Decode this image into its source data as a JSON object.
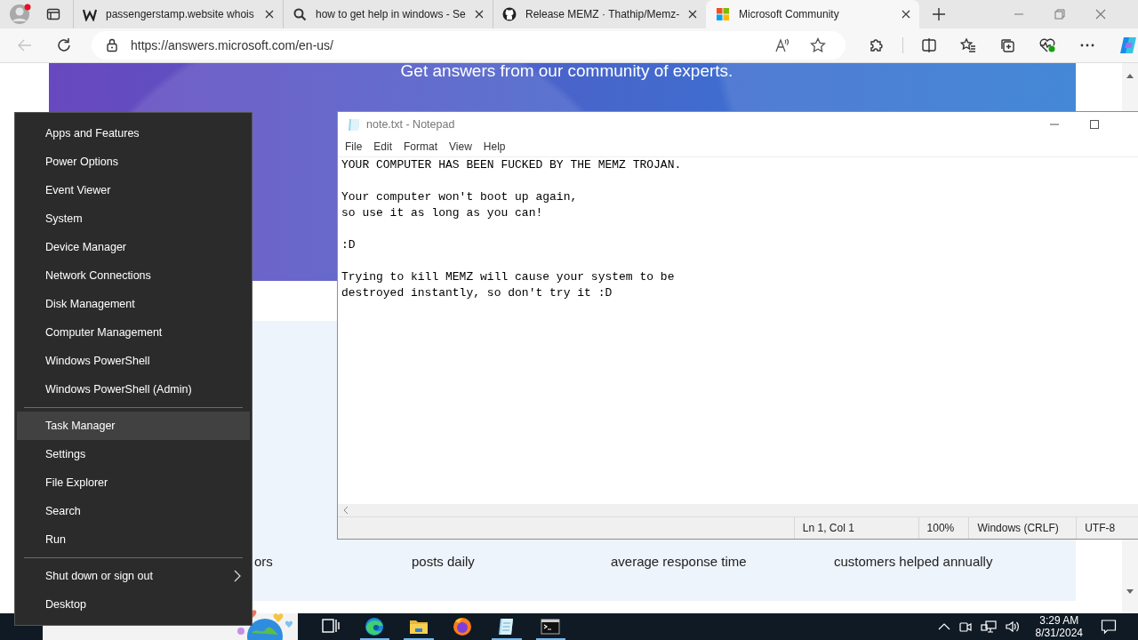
{
  "browser": {
    "tabs": [
      {
        "title": "passengerstamp.website whois",
        "kind": "weebly",
        "selected": false
      },
      {
        "title": "how to get help in windows - Se",
        "kind": "search",
        "selected": false
      },
      {
        "title": "Release MEMZ · Thathip/Memz-",
        "kind": "github",
        "selected": false
      },
      {
        "title": "Microsoft Community",
        "kind": "microsoft",
        "selected": true
      }
    ],
    "back_button": {
      "disabled": true
    },
    "address": "https://answers.microsoft.com/en-us/",
    "page": {
      "headline": "Get answers from our community of experts.",
      "stats": [
        "ors",
        "posts daily",
        "average response time",
        "customers helped annually"
      ]
    }
  },
  "notepad": {
    "title": "note.txt - Notepad",
    "menu": [
      "File",
      "Edit",
      "Format",
      "View",
      "Help"
    ],
    "paragraphs": [
      [
        "YOUR COMPUTER HAS BEEN FUCKED BY THE MEMZ TROJAN."
      ],
      [
        "Your computer won't boot up again,",
        "so use it as long as you can!"
      ],
      [
        ":D"
      ],
      [
        "Trying to kill MEMZ will cause your system to be",
        "destroyed instantly, so don't try it :D"
      ]
    ],
    "status": [
      "Ln 1, Col 1",
      "100%",
      "Windows (CRLF)",
      "UTF-8"
    ]
  },
  "context_menu": {
    "groups": [
      [
        {
          "label": "Apps and Features",
          "selected": false,
          "submenu": false
        },
        {
          "label": "Power Options",
          "selected": false,
          "submenu": false
        },
        {
          "label": "Event Viewer",
          "selected": false,
          "submenu": false
        },
        {
          "label": "System",
          "selected": false,
          "submenu": false
        },
        {
          "label": "Device Manager",
          "selected": false,
          "submenu": false
        },
        {
          "label": "Network Connections",
          "selected": false,
          "submenu": false
        },
        {
          "label": "Disk Management",
          "selected": false,
          "submenu": false
        },
        {
          "label": "Computer Management",
          "selected": false,
          "submenu": false
        },
        {
          "label": "Windows PowerShell",
          "selected": false,
          "submenu": false
        },
        {
          "label": "Windows PowerShell (Admin)",
          "selected": false,
          "submenu": false
        }
      ],
      [
        {
          "label": "Task Manager",
          "selected": true,
          "submenu": false
        },
        {
          "label": "Settings",
          "selected": false,
          "submenu": false
        },
        {
          "label": "File Explorer",
          "selected": false,
          "submenu": false
        },
        {
          "label": "Search",
          "selected": false,
          "submenu": false
        },
        {
          "label": "Run",
          "selected": false,
          "submenu": false
        }
      ],
      [
        {
          "label": "Shut down or sign out",
          "selected": false,
          "submenu": true
        },
        {
          "label": "Desktop",
          "selected": false,
          "submenu": false
        }
      ]
    ]
  },
  "taskbar": {
    "apps": [
      {
        "kind": "task-view",
        "running": false
      },
      {
        "kind": "edge",
        "running": true
      },
      {
        "kind": "explorer",
        "running": true
      },
      {
        "kind": "firefox",
        "running": false
      },
      {
        "kind": "notepad",
        "running": true
      },
      {
        "kind": "terminal",
        "running": true
      }
    ],
    "clock": {
      "time": "3:29 AM",
      "date": "8/31/2024"
    }
  }
}
